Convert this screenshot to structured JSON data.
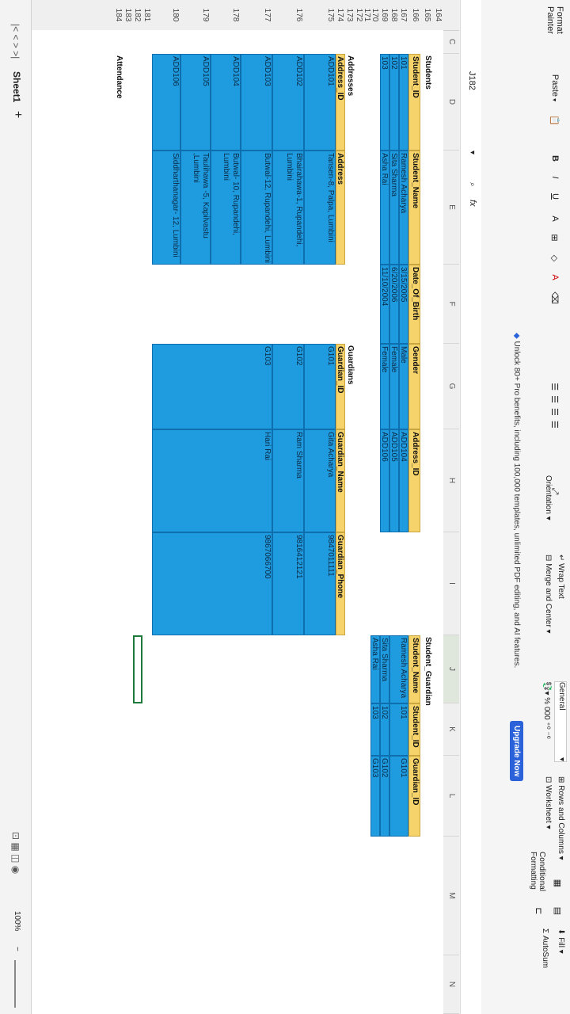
{
  "ribbon": {
    "format_painter": "Format Painter",
    "paste": "Paste",
    "bold": "B",
    "italic": "I",
    "underline": "U",
    "wrap_text": "Wrap Text",
    "merge_center": "Merge and Center",
    "orientation": "Orientation",
    "number_format": "General",
    "percent": "%",
    "thousands": "000",
    "rows_columns": "Rows and Columns",
    "worksheet": "Worksheet",
    "conditional_formatting": "Conditional Formatting",
    "fill": "Fill",
    "autosum": "AutoSum",
    "promo": "Unlock 80+ Pro benefits, including 100,000 templates, unlimited PDF editing, and AI features.",
    "upgrade": "Upgrade Now"
  },
  "formula_bar": {
    "cell_ref": "J182",
    "fx": "fx",
    "value": ""
  },
  "columns": [
    "C",
    "D",
    "E",
    "F",
    "G",
    "H",
    "I",
    "J",
    "K",
    "L",
    "M",
    "N"
  ],
  "rows": [
    "164",
    "165",
    "166",
    "167",
    "168",
    "169",
    "170",
    "171",
    "172",
    "173",
    "174",
    "175",
    "176",
    "177",
    "178",
    "179",
    "180",
    "181",
    "182",
    "183",
    "184"
  ],
  "students": {
    "title": "Students",
    "headers": [
      "Student_ID",
      "Student_Name",
      "Date_Of_Birth",
      "Gender",
      "Address_ID"
    ],
    "rows": [
      [
        "101",
        "Ramesh Acharya",
        "3/15/2005",
        "Male",
        "ADD104"
      ],
      [
        "102",
        "Sita Sharma",
        "6/20/2006",
        "Female",
        "ADD105"
      ],
      [
        "103",
        "Asha Rai",
        "11/10/2004",
        "Female",
        "ADD106"
      ]
    ]
  },
  "student_guardian": {
    "title": "Student_Guardian",
    "headers": [
      "Student_Name",
      "Student_ID",
      "Guardian_ID"
    ],
    "rows": [
      [
        "Ramesh Acharya",
        "101",
        "G101"
      ],
      [
        "Sita Sharma",
        "102",
        "G102"
      ],
      [
        "Asha Rai",
        "103",
        "G103"
      ]
    ]
  },
  "addresses": {
    "title": "Addresses",
    "headers": [
      "Address_ID",
      "Address"
    ],
    "rows": [
      [
        "ADD101",
        "Tansen-8, Palpa, Lumbini"
      ],
      [
        "ADD102",
        "Bhairahawa-1, Rupandehi, Lumbini"
      ],
      [
        "ADD103",
        "Butwal-12, Rupandehi, Lumbini"
      ],
      [
        "ADD104",
        "Butwal- 10, Rupandehi, Lumbini"
      ],
      [
        "ADD105",
        "Taulihawa -5, Kapilvastu ,Lumbini"
      ],
      [
        "ADD106",
        "Siddharthanagar- 12, Lumbini"
      ]
    ]
  },
  "guardians": {
    "title": "Guardians",
    "headers": [
      "Guardian_ID",
      "Guardian_Name",
      "Guardian_Phone"
    ],
    "rows": [
      [
        "G101",
        "Gita Acharya",
        "9847011111"
      ],
      [
        "G102",
        "Ram Sharma",
        "9816412121"
      ],
      [
        "G103",
        "Hari Rai",
        "9867066700"
      ]
    ]
  },
  "labels": {
    "attendance": "Attendance"
  },
  "sheet_tabs": {
    "tab": "Sheet1",
    "add": "+"
  },
  "status": {
    "zoom": "100%"
  },
  "colors": {
    "header_fill": "#f7d46b",
    "cell_fill": "#1f9be0",
    "accent": "#2b62d9"
  }
}
